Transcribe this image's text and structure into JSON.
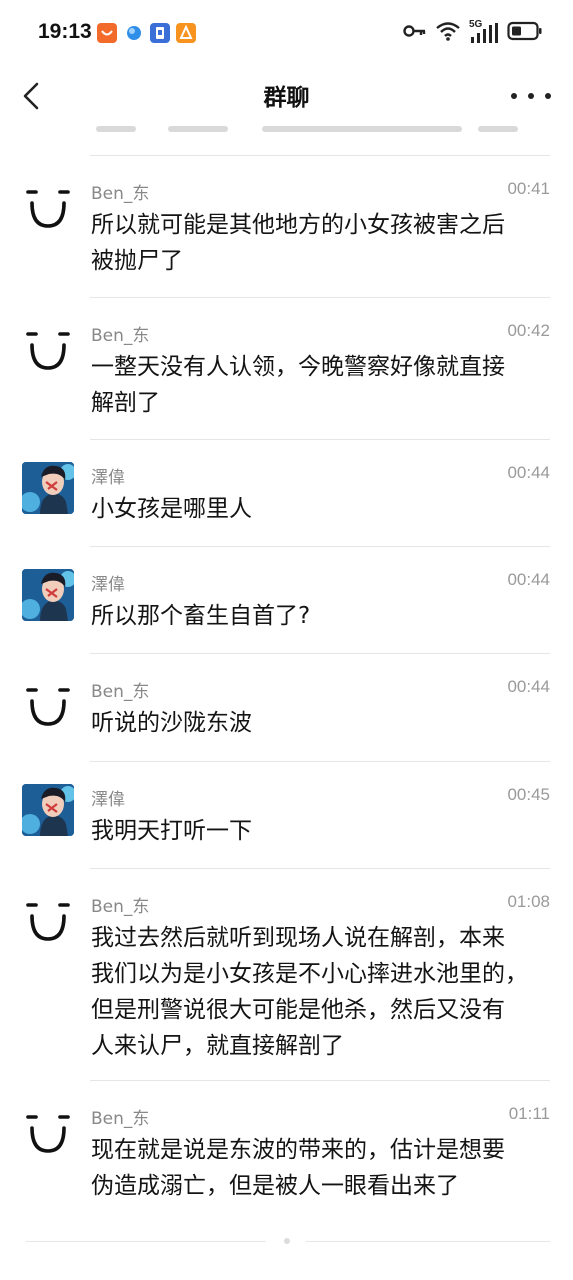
{
  "status_bar": {
    "time": "19:13",
    "notification_icons": [
      "app-notification-icon-orange",
      "app-notification-icon-blue",
      "app-notification-icon-blue-square",
      "app-notification-icon-orange-square"
    ],
    "network_label": "5G",
    "system_icons": [
      "key-icon",
      "wifi-icon",
      "signal-icon",
      "battery-icon"
    ]
  },
  "header": {
    "title": "群聊",
    "back_icon": "chevron-left-icon",
    "more_icon": "more-icon"
  },
  "messages": [
    {
      "sender": "Ben_东",
      "time": "00:41",
      "text": "所以就可能是其他地方的小女孩被害之后\n被抛尸了",
      "avatar": "smiley-face-avatar"
    },
    {
      "sender": "Ben_东",
      "time": "00:42",
      "text": "一整天没有人认领，今晚警察好像就直接\n解剖了",
      "avatar": "smiley-face-avatar"
    },
    {
      "sender": "澤偉",
      "time": "00:44",
      "text": "小女孩是哪里人",
      "avatar": "photo-avatar"
    },
    {
      "sender": "澤偉",
      "time": "00:44",
      "text": "所以那个畜生自首了?",
      "avatar": "photo-avatar"
    },
    {
      "sender": "Ben_东",
      "time": "00:44",
      "text": "听说的沙陇东波",
      "avatar": "smiley-face-avatar"
    },
    {
      "sender": "澤偉",
      "time": "00:45",
      "text": "我明天打听一下",
      "avatar": "photo-avatar"
    },
    {
      "sender": "Ben_东",
      "time": "01:08",
      "text": "我过去然后就听到现场人说在解剖，本来\n我们以为是小女孩是不小心摔进水池里的，\n但是刑警说很大可能是他杀，然后又没有\n人来认尸，就直接解剖了",
      "avatar": "smiley-face-avatar"
    },
    {
      "sender": "Ben_东",
      "time": "01:11",
      "text": "现在就是说是东波的带来的，估计是想要\n伪造成溺亡，但是被人一眼看出来了",
      "avatar": "smiley-face-avatar"
    }
  ]
}
